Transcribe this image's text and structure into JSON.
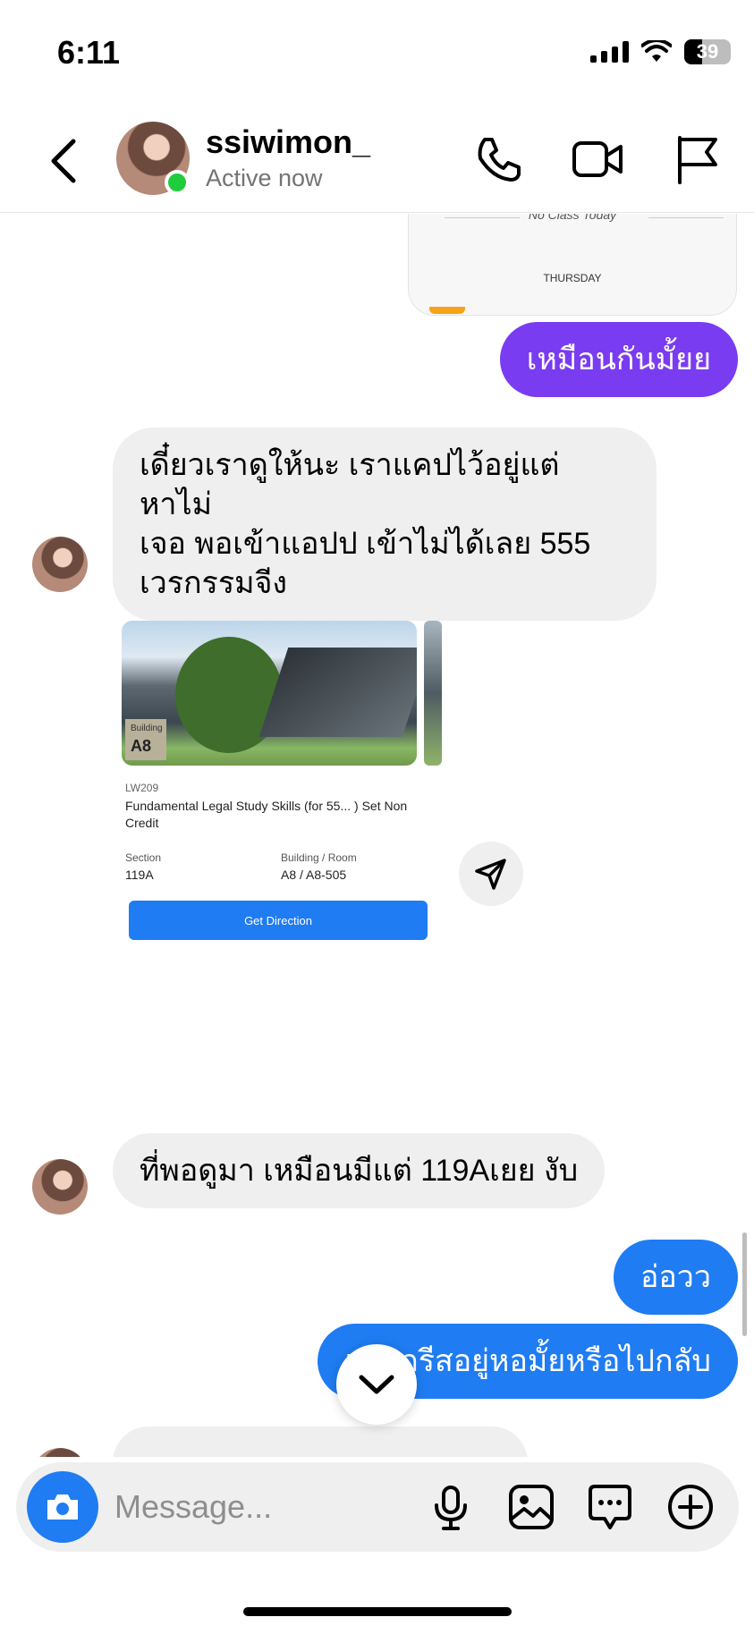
{
  "status_bar": {
    "time": "6:11",
    "battery": "39",
    "battery_level": 0.39
  },
  "header": {
    "username": "ssiwimon_",
    "status": "Active now"
  },
  "icons": {
    "back": "chevron-left-icon",
    "call": "phone-icon",
    "video": "video-camera-icon",
    "report": "flag-icon",
    "camera": "camera-icon",
    "mic": "microphone-icon",
    "gallery": "image-icon",
    "sticker": "chat-bubble-icon",
    "more": "plus-circle-icon",
    "share": "send-icon",
    "scroll_down": "chevron-down-icon"
  },
  "colors": {
    "me_bubble_purple": "#7a3cf0",
    "me_bubble_blue": "#1f7cf2",
    "them_bubble": "#efefef",
    "online": "#1fcc3b"
  },
  "prev_card": {
    "no_class": "No Class Today",
    "day": "THURSDAY"
  },
  "messages": [
    {
      "from": "me",
      "text": "เหมือนกันมั้ยย"
    },
    {
      "from": "them",
      "line1": "เดี๋ยวเราดูให้นะ เราแคปไว้อยู่แต่หาไม่",
      "line2": "เจอ พอเข้าแอปป เข้าไม่ได้เลย 555",
      "line3": "เวรกรรมจีง"
    },
    {
      "from": "them",
      "text": "ที่พอดูมา เหมือนมีแต่  119Aเยย งับ"
    },
    {
      "from": "me",
      "text": "อ่อวว"
    },
    {
      "from": "me",
      "text": "แล้วกรีสอยู่หอมั้ยหรือไปกลับ"
    }
  ],
  "shared_card": {
    "building_tag": "Building",
    "building_code": "A8",
    "course_code": "LW209",
    "course_name": "Fundamental Legal Study Skills (for 55... ) Set Non Credit",
    "section_label": "Section",
    "section_value": "119A",
    "room_label": "Building / Room",
    "room_value": "A8 / A8-505",
    "button_label": "Get Direction"
  },
  "composer": {
    "placeholder": "Message..."
  }
}
